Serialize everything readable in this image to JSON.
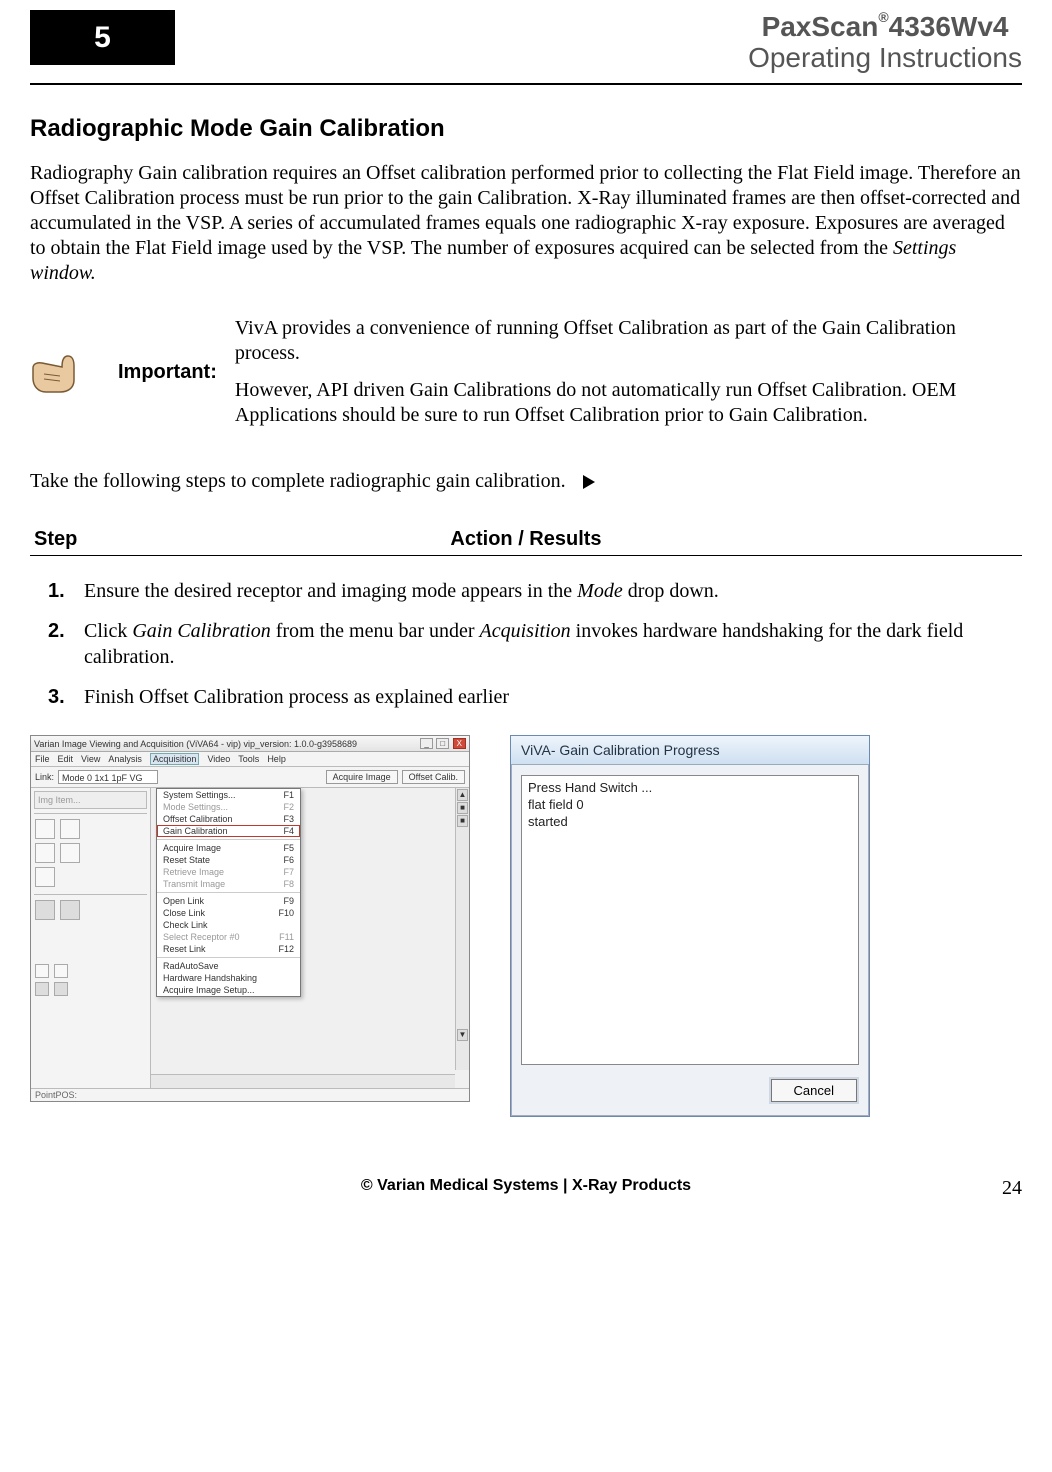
{
  "header": {
    "chapter": "5",
    "brand_product": "PaxScan",
    "brand_reg": "®",
    "brand_model": "4336Wv4",
    "brand_subtitle": "Operating Instructions"
  },
  "section_title": "Radiographic Mode Gain Calibration",
  "intro_paragraph": "Radiography Gain calibration requires an Offset calibration performed prior to collecting the Flat Field image.  Therefore an Offset Calibration process must be run prior to the gain Calibration.  X-Ray illuminated frames are then offset-corrected and accumulated in the VSP.  A series of accumulated frames equals one radiographic X-ray exposure.  Exposures are averaged to obtain the Flat Field image used by the VSP.  The number of exposures acquired can be selected from the ",
  "intro_paragraph_em": "Settings window.",
  "important": {
    "label": "Important:",
    "p1": "VivA provides a convenience of running Offset Calibration as part of the Gain Calibration process.",
    "p2": "However, API driven Gain Calibrations do not automatically run Offset Calibration.  OEM Applications should be sure to run Offset Calibration prior to Gain Calibration."
  },
  "lead_line": "Take the following steps to complete radiographic gain calibration.",
  "table_header": {
    "step": "Step",
    "action": "Action / Results"
  },
  "steps": [
    {
      "num": "1.",
      "pre": "Ensure the desired receptor and imaging mode appears in the ",
      "em": "Mode",
      "post": " drop down."
    },
    {
      "num": "2.",
      "pre": "Click ",
      "em": "Gain Calibration",
      "mid": " from the menu bar under ",
      "em2": "Acquisition",
      "post": " invokes hardware handshaking for the dark field calibration."
    },
    {
      "num": "3.",
      "pre": "Finish Offset Calibration process as explained earlier",
      "em": "",
      "post": ""
    }
  ],
  "viva": {
    "title": "Varian Image Viewing and Acquisition (ViVA64 - vip) vip_version: 1.0.0-g3958689",
    "menu": [
      "File",
      "Edit",
      "View",
      "Analysis",
      "Acquisition",
      "Video",
      "Tools",
      "Help"
    ],
    "active_menu": "Acquisition",
    "link_label": "Link:",
    "mode_value": "Mode 0    1x1 1pF VG",
    "btn_acquire": "Acquire Image",
    "btn_offset": "Offset Calib.",
    "img_item_label": "Img Item...",
    "dropdown": [
      {
        "label": "System Settings...",
        "key": "F1",
        "disabled": false
      },
      {
        "label": "Mode Settings...",
        "key": "F2",
        "disabled": true
      },
      {
        "label": "Offset Calibration",
        "key": "F3",
        "disabled": false
      },
      {
        "label": "Gain Calibration",
        "key": "F4",
        "disabled": false,
        "selected": true
      },
      {
        "sep": true
      },
      {
        "label": "Acquire Image",
        "key": "F5",
        "disabled": false
      },
      {
        "label": "Reset State",
        "key": "F6",
        "disabled": false
      },
      {
        "label": "Retrieve Image",
        "key": "F7",
        "disabled": true
      },
      {
        "label": "Transmit Image",
        "key": "F8",
        "disabled": true
      },
      {
        "sep": true
      },
      {
        "label": "Open Link",
        "key": "F9",
        "disabled": false
      },
      {
        "label": "Close Link",
        "key": "F10",
        "disabled": false
      },
      {
        "label": "Check Link",
        "key": "",
        "disabled": false
      },
      {
        "label": "Select Receptor #0",
        "key": "F11",
        "disabled": true
      },
      {
        "label": "Reset Link",
        "key": "F12",
        "disabled": false
      },
      {
        "sep": true
      },
      {
        "label": "RadAutoSave",
        "key": "",
        "disabled": false
      },
      {
        "label": "Hardware Handshaking",
        "key": "",
        "disabled": false
      },
      {
        "label": "Acquire Image Setup...",
        "key": "",
        "disabled": false
      }
    ],
    "status": "PointPOS:"
  },
  "dialog": {
    "title": "ViVA-  Gain Calibration Progress",
    "body": "Press Hand Switch ...\nflat field 0\nstarted",
    "cancel": "Cancel"
  },
  "footer": {
    "copyright": "© Varian Medical Systems | X-Ray Products",
    "page": "24"
  }
}
